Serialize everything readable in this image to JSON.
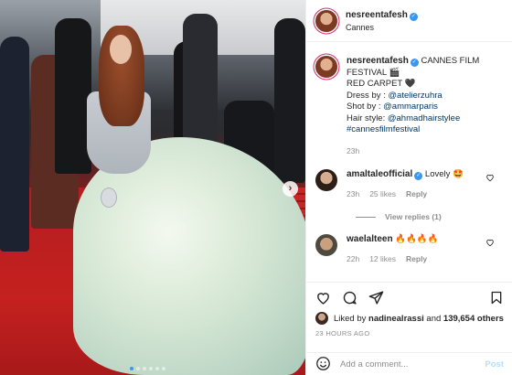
{
  "post": {
    "author": "nesreentafesh",
    "location": "Cannes",
    "carousel": {
      "slide_count": 6,
      "active_index": 0
    }
  },
  "caption": {
    "username": "nesreentafesh",
    "text_line1": "CANNES FILM FESTIVAL 🎬",
    "text_line2": "RED CARPET 🖤",
    "dress_label": "Dress by : ",
    "dress_handle": "@atelierzuhra",
    "shot_label": "Shot by : ",
    "shot_handle": "@ammarparis",
    "hair_label": "Hair style: ",
    "hair_handle": "@ahmadhairstylee",
    "hashtag": "#cannesfilmfestival",
    "time": "23h"
  },
  "comments": [
    {
      "username": "amaltaleofficial",
      "text": "Lovely 🤩",
      "time": "23h",
      "likes": "25 likes",
      "reply": "Reply",
      "view_replies": "View replies (1)"
    },
    {
      "username": "waelalteen",
      "text": "🔥🔥🔥🔥",
      "time": "22h",
      "likes": "12 likes",
      "reply": "Reply"
    }
  ],
  "likes": {
    "prefix": "Liked by ",
    "user": "nadinealrassi",
    "middle": " and ",
    "others": "139,654 others"
  },
  "timestamp": "23 HOURS AGO",
  "add_comment": {
    "placeholder": "Add a comment...",
    "post_label": "Post"
  },
  "icons": {
    "verified": "verified-badge-icon",
    "next": "chevron-right-icon",
    "like": "heart-icon",
    "comment": "comment-icon",
    "share": "paper-plane-icon",
    "save": "bookmark-icon",
    "emoji": "smiley-icon"
  },
  "colors": {
    "link": "#00376b",
    "verified": "#3897f0",
    "muted": "#8e8e8e",
    "post_disabled": "#b2dffc"
  }
}
